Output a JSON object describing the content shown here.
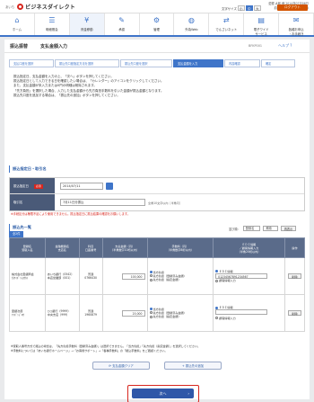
{
  "header": {
    "brand_sub": "あいち",
    "brand": "ビジネスダイレクト",
    "user_line1": "愛銀 太郎 様 2014年07月06日",
    "user_line2": "前回ログイン 2014/07/05",
    "font_label": "文字サイズ",
    "font_small": "小",
    "font_medium": "中",
    "font_large": "大",
    "logout": "ログアウト"
  },
  "gnav": [
    {
      "label": "ホーム",
      "icon": "home-icon",
      "glyph": "⌂"
    },
    {
      "label": "明細照会",
      "icon": "list-icon",
      "glyph": "☰"
    },
    {
      "label": "資金移動",
      "icon": "yen-icon",
      "glyph": "¥"
    },
    {
      "label": "承認",
      "icon": "stamp-icon",
      "glyph": "✎"
    },
    {
      "label": "管理",
      "icon": "gear-icon",
      "glyph": "⚙"
    },
    {
      "label": "外為Web",
      "icon": "globe-icon",
      "glyph": "◍"
    },
    {
      "label": "でんさいネット",
      "icon": "network-icon",
      "glyph": "⇄"
    },
    {
      "label": "電子ワイド\nサービス",
      "icon": "document-icon",
      "glyph": "▤"
    },
    {
      "label": "各種お申込\n・お手続き",
      "icon": "form-icon",
      "glyph": "✉"
    }
  ],
  "page": {
    "category": "振込振替",
    "title": "支払金額入力",
    "code": "BFKP001",
    "help": "ヘルプ"
  },
  "steps": [
    "支払口座を選択",
    "振込先口座指定方法を選択",
    "振込先口座を選択",
    "支払金額を入力",
    "内容確認",
    "確定"
  ],
  "intro": [
    "振込指定日、支払金額を入力の上、「次へ」ボタンを押してください。",
    "振込指定日として入力できる日を確認したい場合は、「カレンダー」のアイコンをクリックしてください。",
    "また、支払金額が未入力または0円の明細は削除されます。",
    "「先方負担」を選択した場合、入力した支払金額から先方負担手数料を引いた金額が振込金額となります。",
    "振込先口座を追加する場合は、「振込先の追加」ボタンを押してください。"
  ],
  "section1": {
    "title": "振込指定日・取引名",
    "date_label": "振込指定日",
    "required": "必須",
    "date_value": "2014/07/11",
    "name_label": "取引名",
    "name_value": "7月11日分振込",
    "name_hint": "全角10文字以内［半角可］"
  },
  "warning": "※手続区分は権限不足により使用できません。振込指定日に振込結果の確認をお願いします。",
  "section2": {
    "title": "振込先一覧",
    "sort_label": "並び順：",
    "sort_value": "登録名",
    "order_value": "昇順",
    "sort_button": "再表示",
    "caption": "全2件"
  },
  "table": {
    "headers": [
      "登録名\n受取人名",
      "金融機関名\n支店名",
      "科目\n口座番号",
      "支払金額（円）\n（半角数字10桁以内）",
      "手数料（円）\n（半角数字8桁以内）",
      "ＥＤＩ情報\n／顧客情報入力\n（半角20桁以内）",
      "操作"
    ],
    "rows": [
      {
        "name1": "株式会社愛銀商会",
        "name2": "ｶ)ｱｲｷﾞﾝｼﾖｳｶｲ",
        "bank1": "あいち銀行（0542）",
        "bank2": "本店営業部（001）",
        "acct1": "普通",
        "acct2": "0766430",
        "amount": "100,000",
        "fee_opt1": "当方負担",
        "fee_opt2": "先方負担（登録済み金額）",
        "fee_opt3": "先方負担（指定金額）",
        "edi_opt1": "ＥＤＩ情報",
        "edi_value": "01234567891234567",
        "edi_opt2": "顧客情報入力",
        "delete": "削除"
      },
      {
        "name1": "愛銀次郎",
        "name2": "ｱｲｷﾞﾝｼﾞﾛｳ",
        "bank1": "○○銀行（9999）",
        "bank2": "中央支店（999）",
        "acct1": "普通",
        "acct2": "1960879",
        "amount": "20,000",
        "fee_opt1": "当方負担",
        "fee_opt2": "先方負担（登録済み金額）",
        "fee_opt3": "先方負担（指定金額）",
        "edi_opt1": "ＥＤＩ情報",
        "edi_value": "",
        "edi_opt2": "顧客情報入力",
        "delete": "削除"
      }
    ]
  },
  "footnote": [
    "※受取人番号方式で振込の場合は、「先方負担手数料（登録済み金額）」は選択できません。「当方負担」「先方負担（指定金額）」を選択してください。",
    "※手数料については「あいち銀行ホームページ」→「お客様サポート」→「各種手数料」の「振込手数料」をご確認ください。"
  ],
  "buttons": {
    "clear": "支払金額クリア",
    "add": "振込先の追加",
    "next": "次へ"
  }
}
